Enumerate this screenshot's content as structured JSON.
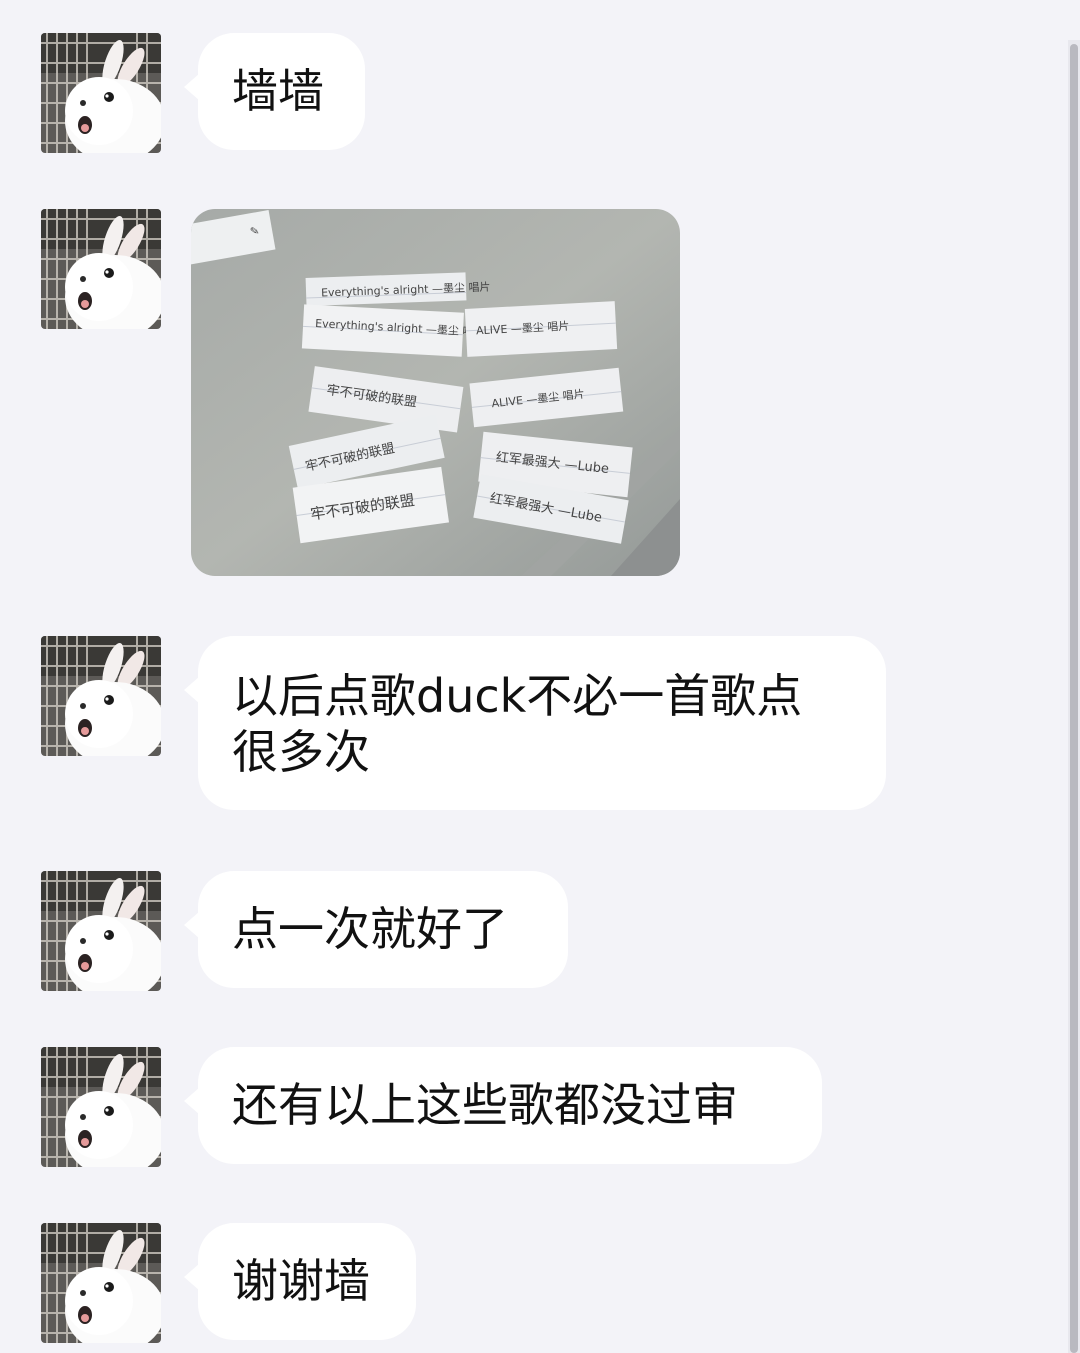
{
  "messages": [
    {
      "type": "text",
      "text": "墙墙"
    },
    {
      "type": "image"
    },
    {
      "type": "text",
      "line1": "以后点歌duck不必一首歌点",
      "line2": "很多次"
    },
    {
      "type": "text",
      "text": "点一次就好了"
    },
    {
      "type": "text",
      "text": "还有以上这些歌都没过审"
    },
    {
      "type": "text",
      "text": "谢谢墙"
    }
  ],
  "photo": {
    "notes": [
      "Everything's alright —墨尘 唱片",
      "Everything's alright —墨尘 唱片",
      "ALIVE —墨尘 唱片",
      "ALIVE —墨尘 唱片",
      "牢不可破的联盟",
      "牢不可破的联盟",
      "牢不可破的联盟",
      "红军最强大 —Lube",
      "红军最强大 —Lube"
    ]
  },
  "colors": {
    "background": "#f3f3f8",
    "bubble": "#ffffff",
    "text": "#111111"
  },
  "icons": {
    "avatar": "white-rabbit-avatar-icon"
  }
}
